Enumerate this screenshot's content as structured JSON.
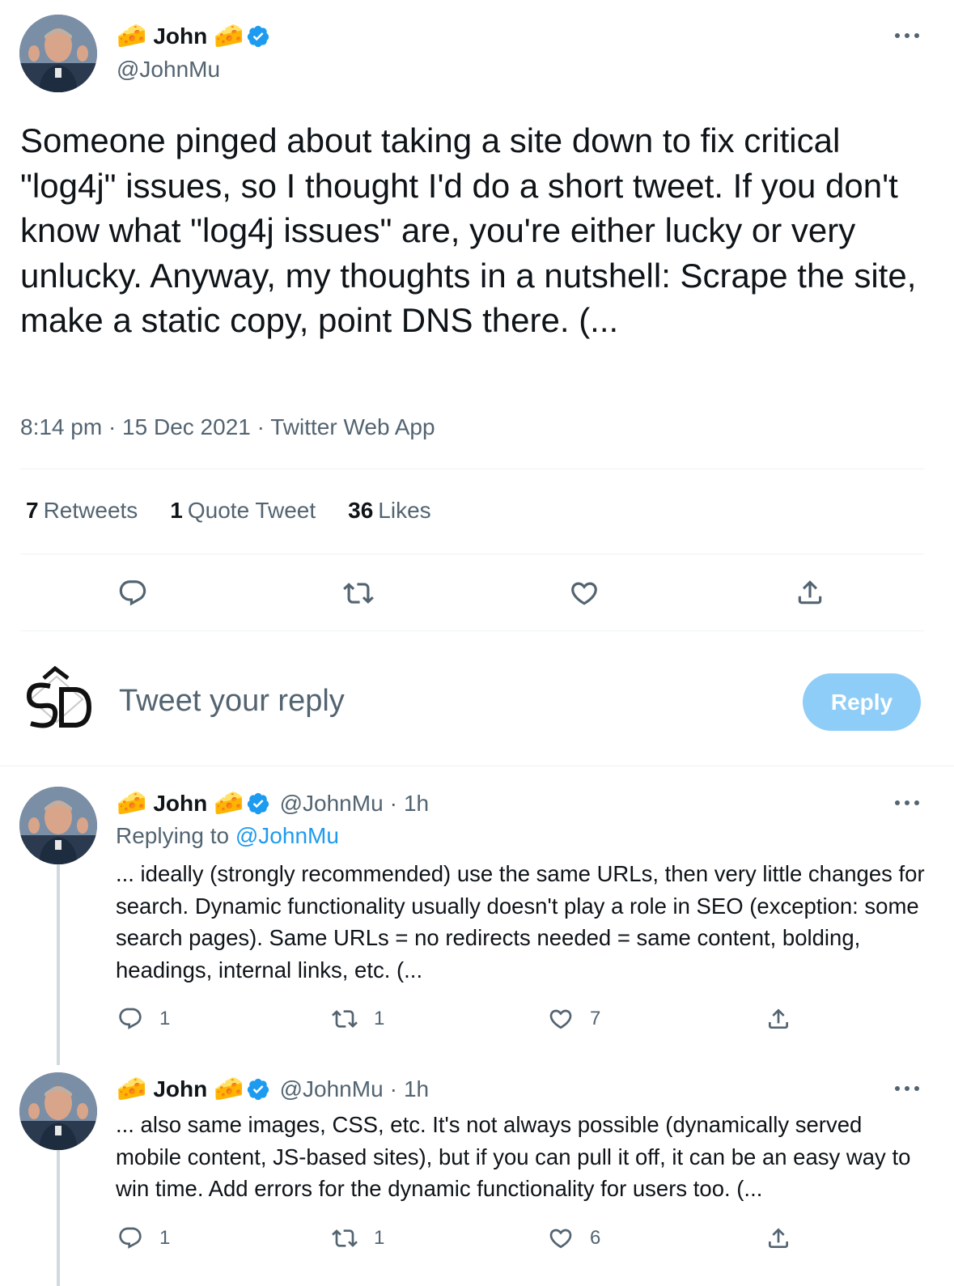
{
  "main_tweet": {
    "author": {
      "name": "John",
      "name_emoji": "🧀",
      "handle": "@JohnMu"
    },
    "text": "Someone pinged about taking a site down to fix critical \"log4j\" issues, so I thought I'd do a short tweet. If you don't know what \"log4j issues\" are, you're either lucky or very unlucky. Anyway, my thoughts in a nutshell: Scrape the site, make a static copy, point DNS there. (...",
    "meta": "8:14 pm · 15 Dec 2021 · Twitter Web App",
    "stats": {
      "retweets_count": "7",
      "retweets_label": "Retweets",
      "quotes_count": "1",
      "quotes_label": "Quote Tweet",
      "likes_count": "36",
      "likes_label": "Likes"
    }
  },
  "reply_box": {
    "placeholder": "Tweet your reply",
    "button_label": "Reply"
  },
  "replies": [
    {
      "name": "John",
      "name_emoji": "🧀",
      "handle": "@JohnMu",
      "separator": "·",
      "time": "1h",
      "replying_prefix": "Replying to",
      "replying_to": "@JohnMu",
      "text": "... ideally (strongly recommended) use the same URLs, then very little changes for search. Dynamic functionality usually doesn't play a role in SEO (exception: some search pages). Same URLs = no redirects needed = same content, bolding, headings, internal links, etc. (...",
      "reply_count": "1",
      "retweet_count": "1",
      "like_count": "7"
    },
    {
      "name": "John",
      "name_emoji": "🧀",
      "handle": "@JohnMu",
      "separator": "·",
      "time": "1h",
      "text": "... also same images, CSS, etc. It's not always possible (dynamically served mobile content, JS-based sites), but if you can pull it off, it can be an easy way to win time. Add errors for the dynamic functionality for users too. (...",
      "reply_count": "1",
      "retweet_count": "1",
      "like_count": "6"
    }
  ],
  "colors": {
    "accent": "#1d9bf0",
    "reply_button": "#8ecdf7",
    "secondary_text": "#536471"
  }
}
